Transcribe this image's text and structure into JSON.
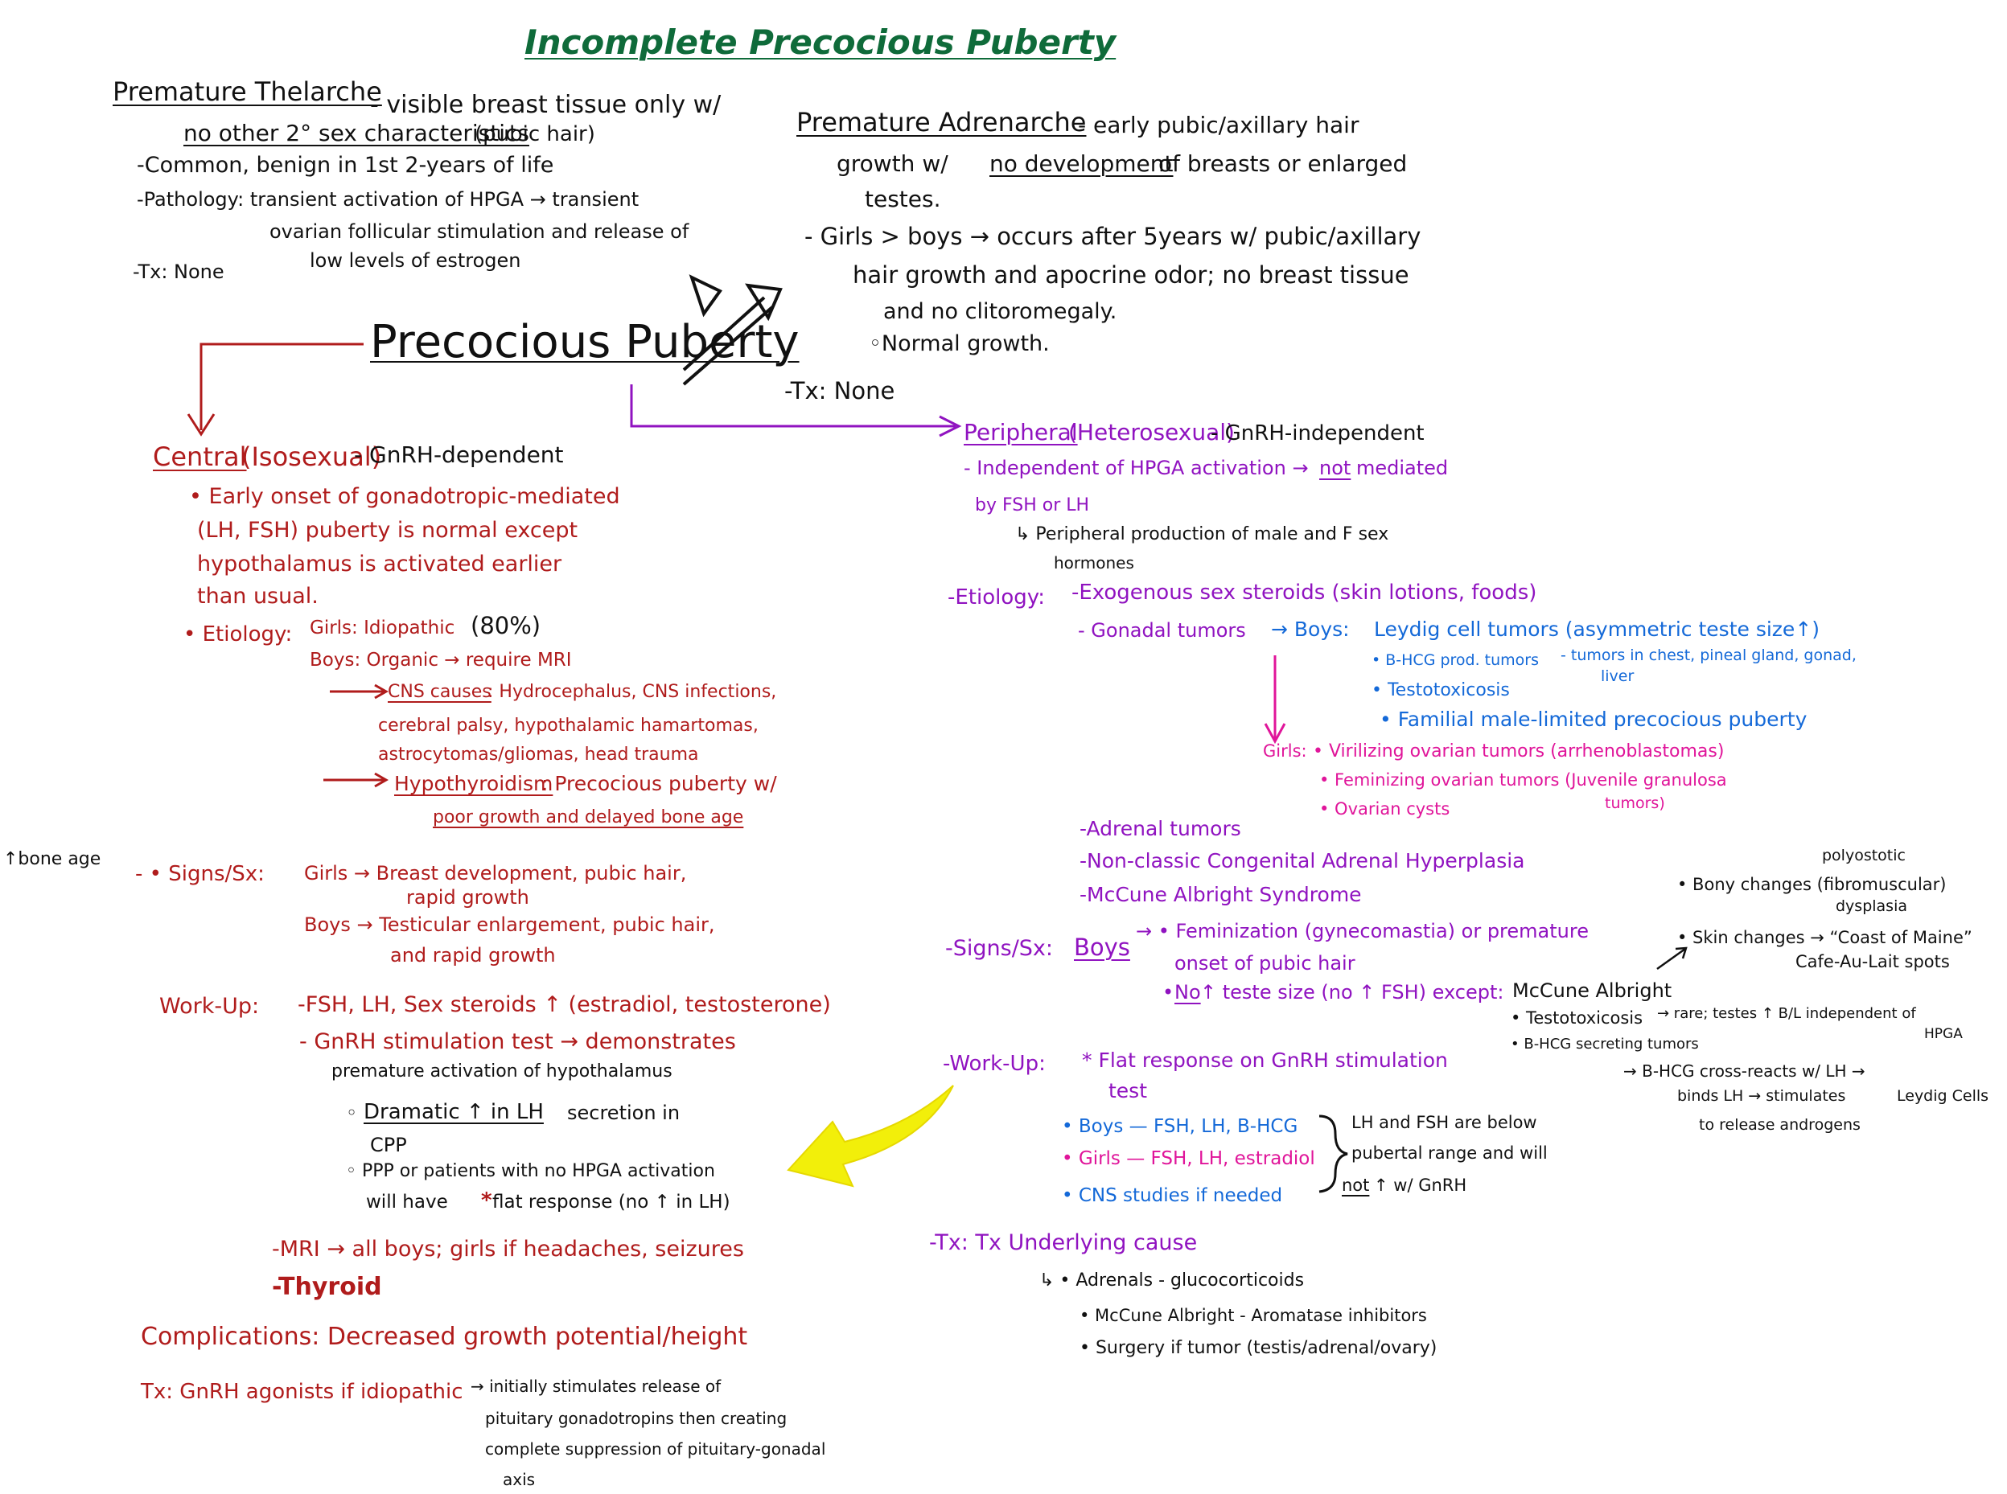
{
  "title": "Incomplete Precocious Puberty",
  "thelarche": {
    "heading": "Premature Thelarche",
    "l1": "- visible breast tissue only w/",
    "l2a": "no other 2° sex characteristics",
    "l2b": " (pubic hair)",
    "l3": "-Common, benign in 1st 2-years of life",
    "l4": "-Pathology: transient activation of HPGA → transient",
    "l5": "ovarian follicular stimulation and release of",
    "l6": "low levels of estrogen",
    "l7": "-Tx: None"
  },
  "adrenarche": {
    "heading": "Premature Adrenarche",
    "l1": "- early pubic/axillary hair",
    "l2a": "growth w/ ",
    "l2b": "no development",
    "l2c": " of breasts or enlarged",
    "l3": "testes.",
    "l4": "- Girls > boys → occurs after 5years w/ pubic/axillary",
    "l5": "hair growth and apocrine odor; no breast tissue",
    "l6": "and no clitoromegaly.",
    "l7": "◦Normal growth.",
    "l8": "-Tx: None"
  },
  "main_title": "Precocious Puberty",
  "central": {
    "heading": "Central",
    "heading2": " (Isosexual)",
    "dep": " - GnRH-dependent",
    "d1": "• Early onset of gonadotropic-mediated",
    "d2": "(LH, FSH) puberty is normal except",
    "d3": "hypothalamus is activated earlier",
    "d4": "than usual.",
    "etio_label": "• Etiology:",
    "etio_girls_a": "Girls: Idiopathic ",
    "etio_girls_b": "(80%)",
    "etio_boys": "Boys: Organic → require MRI",
    "cns_label": "CNS causes",
    "cns1": ": Hydrocephalus, CNS infections,",
    "cns2": "cerebral palsy, hypothalamic hamartomas,",
    "cns3": "astrocytomas/gliomas, head trauma",
    "hypo_label": "Hypothyroidism",
    "hypo1": ": Precocious puberty w/",
    "hypo2": "poor growth and delayed bone age",
    "side_note": "↑bone age",
    "signs_label": "- • Signs/Sx:",
    "signs_girls": "Girls → Breast development, pubic hair,",
    "signs_girls2": "rapid growth",
    "signs_boys": "Boys → Testicular enlargement, pubic hair,",
    "signs_boys2": "and rapid growth",
    "wu_label": "Work-Up:",
    "wu1": "-FSH, LH, Sex steroids ↑ (estradiol, testosterone)",
    "wu2": "- GnRH stimulation test → demonstrates",
    "wu3": "premature activation of hypothalamus",
    "wu4a": "◦",
    "wu4b": "Dramatic ↑ in LH",
    "wu4c": " secretion in",
    "wu5": "CPP",
    "wu6": "◦ PPP or patients with no HPGA activation",
    "wu7a": "will have ",
    "wu7b": "*",
    "wu7c": "flat response (no ↑ in LH)",
    "mri": "-MRI → all boys; girls if headaches, seizures",
    "thyroid": "-Thyroid",
    "comp": "Complications: Decreased growth potential/height",
    "tx_label": "Tx: GnRH agonists if idiopathic",
    "tx1": "→ initially stimulates release of",
    "tx2": "pituitary gonadotropins then creating",
    "tx3": "complete suppression of pituitary-gonadal",
    "tx4": "axis"
  },
  "peripheral": {
    "heading": "Peripheral",
    "heading2": " (Heterosexual)",
    "indep": " - GnRH-independent",
    "p1a": "- Independent of HPGA activation → ",
    "p1b": "not",
    "p1c": " mediated",
    "p2": "by FSH or LH",
    "p3": "↳ Peripheral production of male and F sex",
    "p4": "hormones",
    "etio_label": "-Etiology:",
    "etio1": "-Exogenous sex steroids (skin lotions, foods)",
    "etio2": "- Gonadal tumors",
    "boys_label": "→ Boys:",
    "boys1": "Leydig cell tumors (asymmetric teste size↑)",
    "boys2": "• B-HCG prod. tumors",
    "boys2b": "- tumors in chest, pineal gland, gonad,",
    "boys2c": "liver",
    "boys3": "• Testotoxicosis",
    "boys4": "• Familial male-limited precocious puberty",
    "girls_label": "Girls:",
    "girls1": "• Virilizing ovarian tumors (arrhenoblastomas)",
    "girls2": "• Feminizing ovarian tumors (Juvenile granulosa",
    "girls2b": "tumors)",
    "girls3": "• Ovarian cysts",
    "etio3": "-Adrenal tumors",
    "etio4": "-Non-classic Congenital Adrenal Hyperplasia",
    "etio5": "-McCune Albright Syndrome",
    "signs_label": "-Signs/Sx:",
    "signs_boys": "Boys",
    "signs1": "→ • Feminization (gynecomastia) or premature",
    "signs2": "onset of pubic hair",
    "signs3a": "• ",
    "signs3b": "No",
    "signs3c": " ↑ teste size (no ↑ FSH) except:",
    "wu_label": "-Work-Up:",
    "wu1": "* Flat response on GnRH stimulation",
    "wu2": "test",
    "wu_boys": "• Boys — FSH, LH, B-HCG",
    "wu_girls": "• Girls — FSH, LH, estradiol",
    "wu_cns": "• CNS studies if needed",
    "brace1": "LH and FSH are below",
    "brace2": "pubertal range and will",
    "brace3a": "not",
    "brace3b": " ↑ w/ GnRH",
    "tx_label": "-Tx: Tx Underlying cause",
    "tx1": "↳ • Adrenals - glucocorticoids",
    "tx2": "• McCune Albright - Aromatase inhibitors",
    "tx3": "• Surgery if tumor (testis/adrenal/ovary)"
  },
  "mccune": {
    "label": "McCune Albright",
    "bony1": "polyostotic",
    "bony2": "• Bony changes (fibromuscular)",
    "bony3": "dysplasia",
    "skin": "• Skin changes → “Coast of Maine”",
    "skin2": "Cafe-Au-Lait spots",
    "testo": "• Testotoxicosis",
    "testo2": "→ rare; testes ↑ B/L independent of",
    "testo3": "HPGA",
    "bhcg": "• B-HCG secreting tumors",
    "bhcg2": "→ B-HCG cross-reacts w/ LH →",
    "bhcg3": "binds LH → stimulates",
    "bhcg3b": "Leydig Cells",
    "bhcg4": "to release androgens"
  }
}
